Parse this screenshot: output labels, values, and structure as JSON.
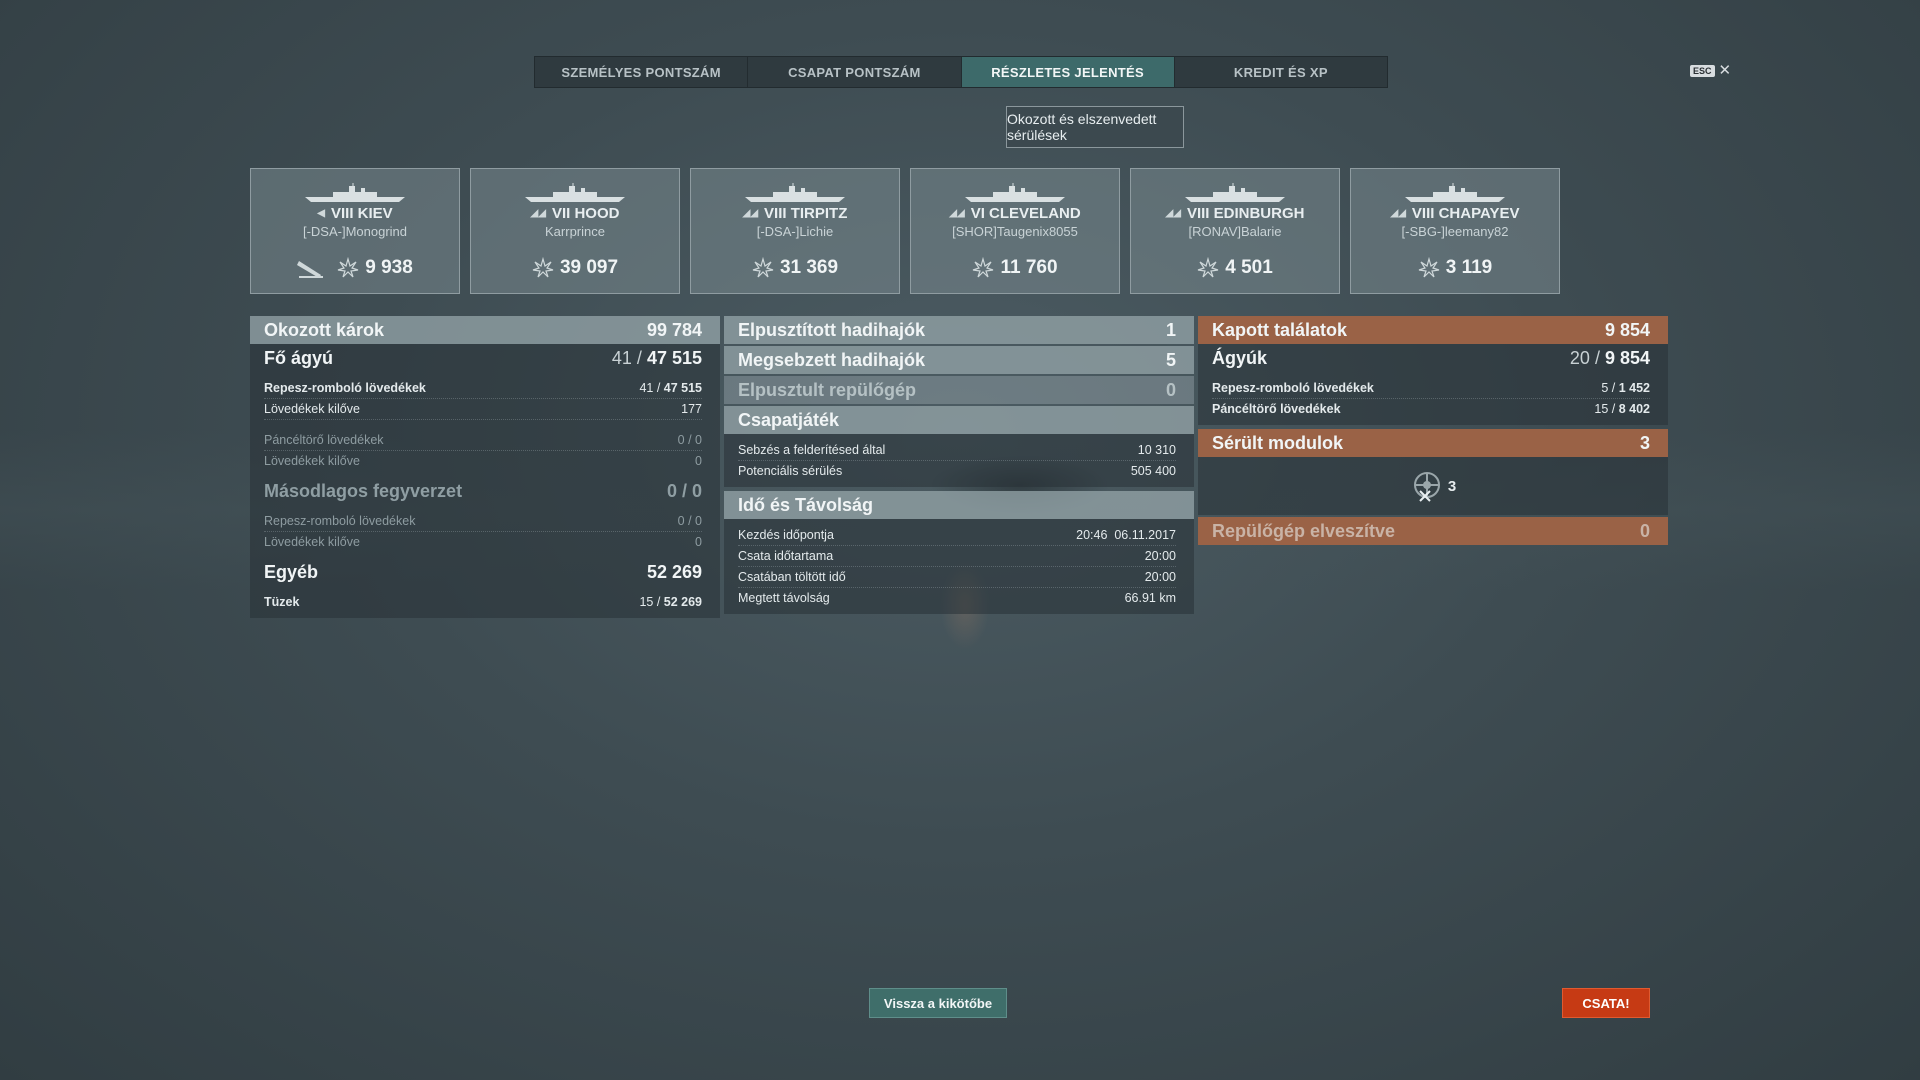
{
  "tabs": [
    "SZEMÉLYES PONTSZÁM",
    "CSAPAT PONTSZÁM",
    "RÉSZLETES JELENTÉS",
    "KREDIT ÉS XP"
  ],
  "esc_label": "ESC",
  "subtab": "Okozott és elszenvedett sérülések",
  "ships": [
    {
      "tier_name": "VIII KIEV",
      "player": "[-DSA-]Monogrind",
      "damage": "9 938",
      "class_icon": "destroyer-icon"
    },
    {
      "tier_name": "VII HOOD",
      "player": "Karrprince",
      "damage": "39 097",
      "class_icon": "battleship-icon"
    },
    {
      "tier_name": "VIII TIRPITZ",
      "player": "[-DSA-]Lichie",
      "damage": "31 369",
      "class_icon": "battleship-icon"
    },
    {
      "tier_name": "VI CLEVELAND",
      "player": "[SHOR]Taugenix8055",
      "damage": "11 760",
      "class_icon": "cruiser-icon"
    },
    {
      "tier_name": "VIII EDINBURGH",
      "player": "[RONAV]Balarie",
      "damage": "4 501",
      "class_icon": "cruiser-icon"
    },
    {
      "tier_name": "VIII CHAPAYEV",
      "player": "[-SBG-]leemany82",
      "damage": "3 119",
      "class_icon": "cruiser-icon"
    }
  ],
  "col1": {
    "dealt": {
      "label": "Okozott károk",
      "value": "99 784"
    },
    "main": {
      "label": "Fő ágyú",
      "hits": "41",
      "value": "47 515"
    },
    "main_rows": [
      {
        "label": "Repesz-romboló lövedékek",
        "hits": "41",
        "value": "47 515"
      },
      {
        "label": "Lövedékek kilőve",
        "value": "177"
      },
      {
        "label": "Páncéltörő lövedékek",
        "hits": "0",
        "value": "0"
      },
      {
        "label": "Lövedékek kilőve",
        "value": "0"
      }
    ],
    "secondary": {
      "label": "Másodlagos fegyverzet",
      "hits": "0",
      "value": "0"
    },
    "secondary_rows": [
      {
        "label": "Repesz-romboló lövedékek",
        "hits": "0",
        "value": "0"
      },
      {
        "label": "Lövedékek kilőve",
        "value": "0"
      }
    ],
    "other": {
      "label": "Egyéb",
      "value": "52 269"
    },
    "other_rows": [
      {
        "label": "Tüzek",
        "hits": "15",
        "value": "52 269"
      }
    ]
  },
  "col2": {
    "destroyed": {
      "label": "Elpusztított hadihajók",
      "value": "1"
    },
    "damaged": {
      "label": "Megsebzett hadihajók",
      "value": "5"
    },
    "planes": {
      "label": "Elpusztult repülőgép",
      "value": "0"
    },
    "team": {
      "label": "Csapatjáték"
    },
    "team_rows": [
      {
        "label": "Sebzés a felderítésed által",
        "value": "10 310"
      },
      {
        "label": "Potenciális sérülés",
        "value": "505 400"
      }
    ],
    "time": {
      "label": "Idő és Távolság"
    },
    "time_rows": [
      {
        "label": "Kezdés időpontja",
        "value": "20:46  06.11.2017"
      },
      {
        "label": "Csata időtartama",
        "value": "20:00"
      },
      {
        "label": "Csatában töltött idő",
        "value": "20:00"
      },
      {
        "label": "Megtett távolság",
        "value": "66.91 km"
      }
    ]
  },
  "col3": {
    "received": {
      "label": "Kapott találatok",
      "value": "9 854"
    },
    "guns": {
      "label": "Ágyúk",
      "hits": "20",
      "value": "9 854"
    },
    "guns_rows": [
      {
        "label": "Repesz-romboló lövedékek",
        "hits": "5",
        "value": "1 452"
      },
      {
        "label": "Páncéltörő lövedékek",
        "hits": "15",
        "value": "8 402"
      }
    ],
    "modules": {
      "label": "Sérült modulok",
      "value": "3",
      "icon_count": "3"
    },
    "planes_lost": {
      "label": "Repülőgép elveszítve",
      "value": "0"
    }
  },
  "buttons": {
    "port": "Vissza a kikötőbe",
    "battle": "CSATA!"
  },
  "colors": {
    "accent_teal": "#3d6a6a",
    "received_orange": "#9a6246",
    "battle_red": "#c63a14"
  }
}
